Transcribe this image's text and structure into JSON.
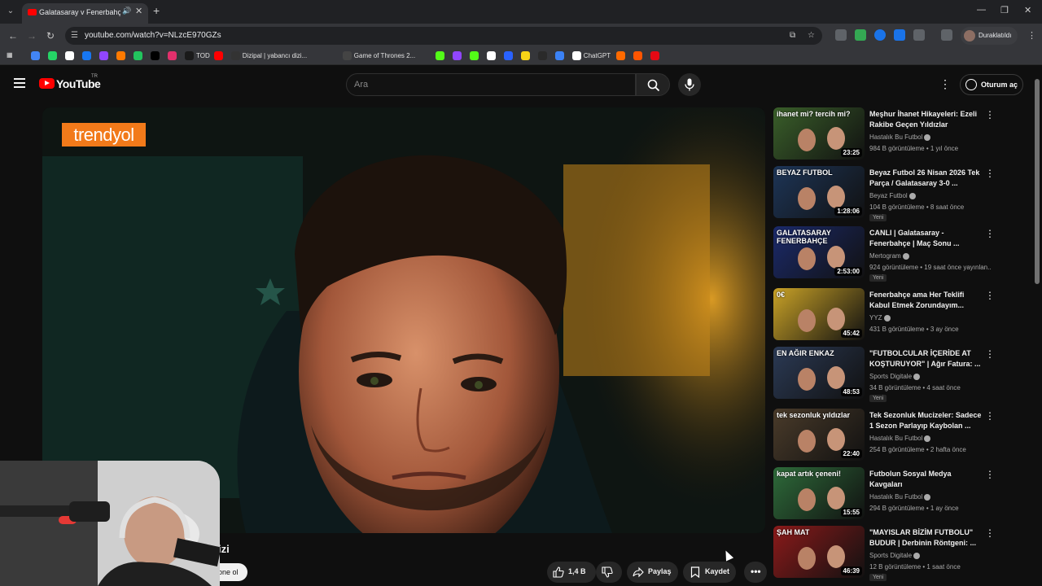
{
  "browser": {
    "tab_title": "Galatasaray v Fenerbahçe D...",
    "url": "youtube.com/watch?v=NLzcE970GZs",
    "profile_label": "Duraklatıldı",
    "bookmarks": [
      {
        "label": "",
        "color": "#4285f4"
      },
      {
        "label": "",
        "color": "#25d366"
      },
      {
        "label": "",
        "color": "#ffffff"
      },
      {
        "label": "",
        "color": "#1877f2"
      },
      {
        "label": "",
        "color": "#9146ff"
      },
      {
        "label": "",
        "color": "#ff7a00"
      },
      {
        "label": "",
        "color": "#22c55e"
      },
      {
        "label": "",
        "color": "#000000"
      },
      {
        "label": "",
        "color": "#e1306c"
      },
      {
        "label": "TOD",
        "color": "#1a1a1a"
      },
      {
        "label": "",
        "color": "#ff0000"
      },
      {
        "label": "Dizipal | yabancı dizi...",
        "color": "#333333"
      },
      {
        "label": "Game of Thrones 2...",
        "color": "#444444"
      },
      {
        "label": "",
        "color": "#53fc18"
      },
      {
        "label": "",
        "color": "#9146ff"
      },
      {
        "label": "",
        "color": "#53fc18"
      },
      {
        "label": "",
        "color": "#ffffff"
      },
      {
        "label": "",
        "color": "#2962ff"
      },
      {
        "label": "",
        "color": "#f7d417"
      },
      {
        "label": "",
        "color": "#2a2a2a"
      },
      {
        "label": "",
        "color": "#3b82f6"
      },
      {
        "label": "ChatGPT",
        "color": "#ffffff"
      },
      {
        "label": "",
        "color": "#ff6a00"
      },
      {
        "label": "",
        "color": "#ff5500"
      },
      {
        "label": "",
        "color": "#e50914"
      }
    ]
  },
  "youtube": {
    "logo_text": "YouTube",
    "country_code": "TR",
    "search_placeholder": "Ara",
    "signin_label": "Oturum aç"
  },
  "player": {
    "sponsor_logo": "trendyol"
  },
  "below_player": {
    "title_fragment": "izi",
    "subscribe_fragment": "bone ol",
    "like_count": "1,4 B",
    "share_label": "Paylaş",
    "save_label": "Kaydet"
  },
  "recommendations": [
    {
      "title": "Meşhur İhanet Hikayeleri: Ezeli Rakibe Geçen Yıldızlar",
      "channel": "Hastalık Bu Futbol",
      "meta": "984 B görüntüleme • 1 yıl önce",
      "duration": "23:25",
      "badge": "",
      "thumb_text": "ihanet mi? tercih mi?",
      "thumb_color": "#3a5f2a"
    },
    {
      "title": "Beyaz Futbol 26 Nisan 2026 Tek Parça / Galatasaray 3-0 ...",
      "channel": "Beyaz Futbol",
      "meta": "104 B görüntüleme • 8 saat önce",
      "duration": "1:28:06",
      "badge": "Yeni",
      "thumb_text": "BEYAZ FUTBOL",
      "thumb_color": "#1d3557"
    },
    {
      "title": "CANLI | Galatasaray - Fenerbahçe | Maç Sonu ...",
      "channel": "Mertogram",
      "meta": "924 görüntüleme • 19 saat önce yayınlan...",
      "duration": "2:53:00",
      "badge": "Yeni",
      "thumb_text": "GALATASARAY FENERBAHÇE",
      "thumb_color": "#1b2a6b"
    },
    {
      "title": "Fenerbahçe ama Her Teklifi Kabul Etmek Zorundayım...",
      "channel": "YYZ",
      "meta": "431 B görüntüleme • 3 ay önce",
      "duration": "45:42",
      "badge": "",
      "thumb_text": "0€",
      "thumb_color": "#c9a227"
    },
    {
      "title": "\"FUTBOLCULAR İÇERİDE AT KOŞTURUYOR\" | Ağır Fatura: ...",
      "channel": "Sports Digitale",
      "meta": "34 B görüntüleme • 4 saat önce",
      "duration": "48:53",
      "badge": "Yeni",
      "thumb_text": "EN AĞIR ENKAZ",
      "thumb_color": "#2b3a55"
    },
    {
      "title": "Tek Sezonluk Mucizeler: Sadece 1 Sezon Parlayıp Kaybolan ...",
      "channel": "Hastalık Bu Futbol",
      "meta": "254 B görüntüleme • 2 hafta önce",
      "duration": "22:40",
      "badge": "",
      "thumb_text": "tek sezonluk yıldızlar",
      "thumb_color": "#4a3b2a"
    },
    {
      "title": "Futbolun Sosyal Medya Kavgaları",
      "channel": "Hastalık Bu Futbol",
      "meta": "294 B görüntüleme • 1 ay önce",
      "duration": "15:55",
      "badge": "",
      "thumb_text": "kapat artık çeneni!",
      "thumb_color": "#2e6b3a"
    },
    {
      "title": "\"MAYISLAR BİZİM FUTBOLU\" BUDUR | Derbinin Röntgeni: ...",
      "channel": "Sports Digitale",
      "meta": "12 B görüntüleme • 1 saat önce",
      "duration": "46:39",
      "badge": "Yeni",
      "thumb_text": "ŞAH MAT",
      "thumb_color": "#8b1a1a"
    }
  ]
}
